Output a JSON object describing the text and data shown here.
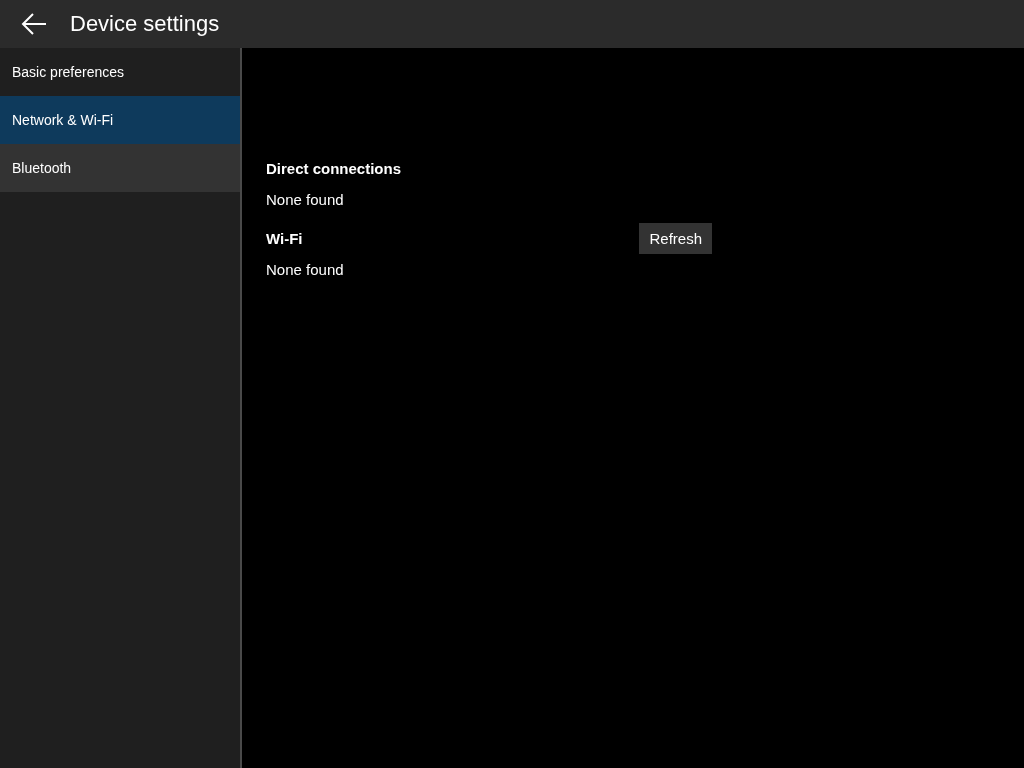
{
  "header": {
    "title": "Device settings"
  },
  "sidebar": {
    "items": [
      {
        "label": "Basic preferences",
        "selected": false,
        "hovered": false
      },
      {
        "label": "Network & Wi-Fi",
        "selected": true,
        "hovered": false
      },
      {
        "label": "Bluetooth",
        "selected": false,
        "hovered": true
      }
    ]
  },
  "sections": [
    {
      "title": "Direct connections",
      "status": "None found"
    },
    {
      "title": "Wi-Fi",
      "status": "None found",
      "button": "Refresh"
    }
  ]
}
